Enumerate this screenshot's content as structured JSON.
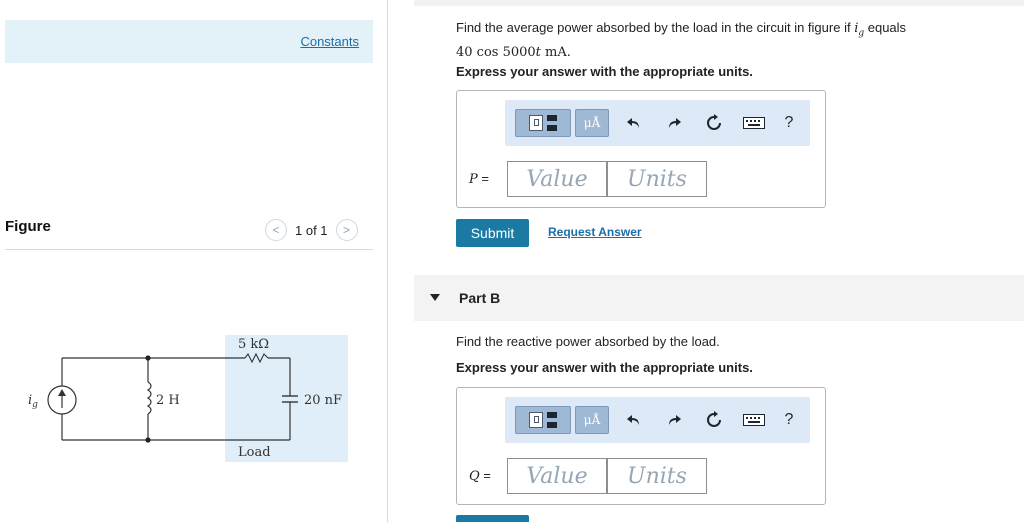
{
  "left": {
    "constants_link": "Constants",
    "figure_title": "Figure",
    "pager": {
      "prev": "<",
      "text": "1 of 1",
      "next": ">"
    },
    "circuit": {
      "source_label": "i",
      "source_sub": "g",
      "inductor_label": "2 H",
      "resistor_label": "5 kΩ",
      "capacitor_label": "20 nF",
      "load_label": "Load"
    }
  },
  "partA": {
    "question_prefix": "Find the average power absorbed by the load in the circuit in figure if ",
    "question_var": "i",
    "question_var_sub": "g",
    "question_suffix": " equals",
    "question_expr_num": "40 cos 5000",
    "question_expr_t": "t",
    "question_expr_unit": " mA.",
    "instruction": "Express your answer with the appropriate units.",
    "toolbar": {
      "units_button": "μÅ",
      "help": "?"
    },
    "var_symbol": "P",
    "var_eq": " =",
    "value_placeholder": "Value",
    "units_placeholder": "Units",
    "submit": "Submit",
    "request_answer": "Request Answer"
  },
  "partB": {
    "label": "Part B",
    "question": "Find the reactive power absorbed by the load.",
    "instruction": "Express your answer with the appropriate units.",
    "toolbar": {
      "units_button": "μÅ",
      "help": "?"
    },
    "var_symbol": "Q",
    "var_eq": " =",
    "value_placeholder": "Value",
    "units_placeholder": "Units"
  },
  "colors": {
    "accent": "#1b7aa3",
    "link": "#1b6fa7",
    "panel": "#e3f1f8",
    "toolbar": "#dde9f7"
  }
}
